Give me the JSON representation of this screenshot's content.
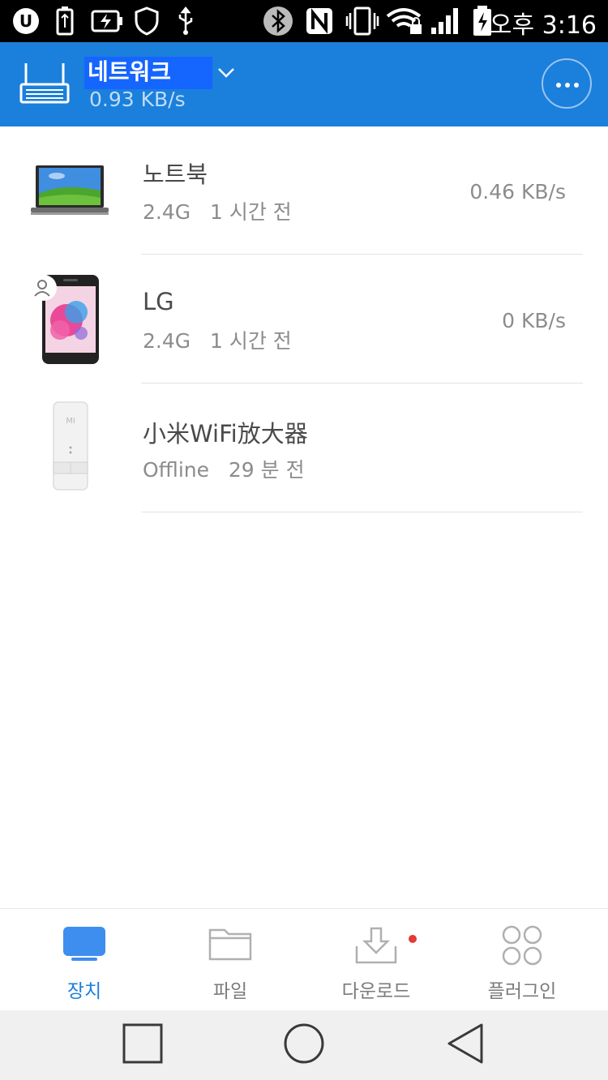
{
  "status_bar": {
    "time": "오후 3:16",
    "icons": [
      "uplus-icon",
      "usb-battery-icon",
      "battery-charging-icon",
      "shield-icon",
      "usb-icon",
      "bluetooth-icon",
      "nfc-icon",
      "vibrate-icon",
      "wifi-lock-icon",
      "signal-icon",
      "battery-icon"
    ]
  },
  "header": {
    "title": "네트워크",
    "speed": "0.93 KB/s",
    "accent_color": "#1b7fdc"
  },
  "devices": [
    {
      "name": "노트북",
      "band": "2.4G",
      "last_seen": "1 시간 전",
      "speed": "0.46 KB/s",
      "thumb": "laptop-thumbnail"
    },
    {
      "name": "LG",
      "band": "2.4G",
      "last_seen": "1 시간 전",
      "speed": "0 KB/s",
      "thumb": "phone-thumbnail"
    },
    {
      "name": "小米WiFi放大器",
      "band": "Offline",
      "last_seen": "29 분 전",
      "speed": "",
      "thumb": "wifi-extender-thumbnail"
    }
  ],
  "bottom_nav": {
    "items": [
      {
        "label": "장치",
        "icon": "device-icon",
        "active": true
      },
      {
        "label": "파일",
        "icon": "folder-icon",
        "active": false
      },
      {
        "label": "다운로드",
        "icon": "download-icon",
        "active": false
      },
      {
        "label": "플러그인",
        "icon": "plugin-icon",
        "active": false
      }
    ]
  },
  "system_nav": [
    "recents-button",
    "home-button",
    "back-button"
  ]
}
